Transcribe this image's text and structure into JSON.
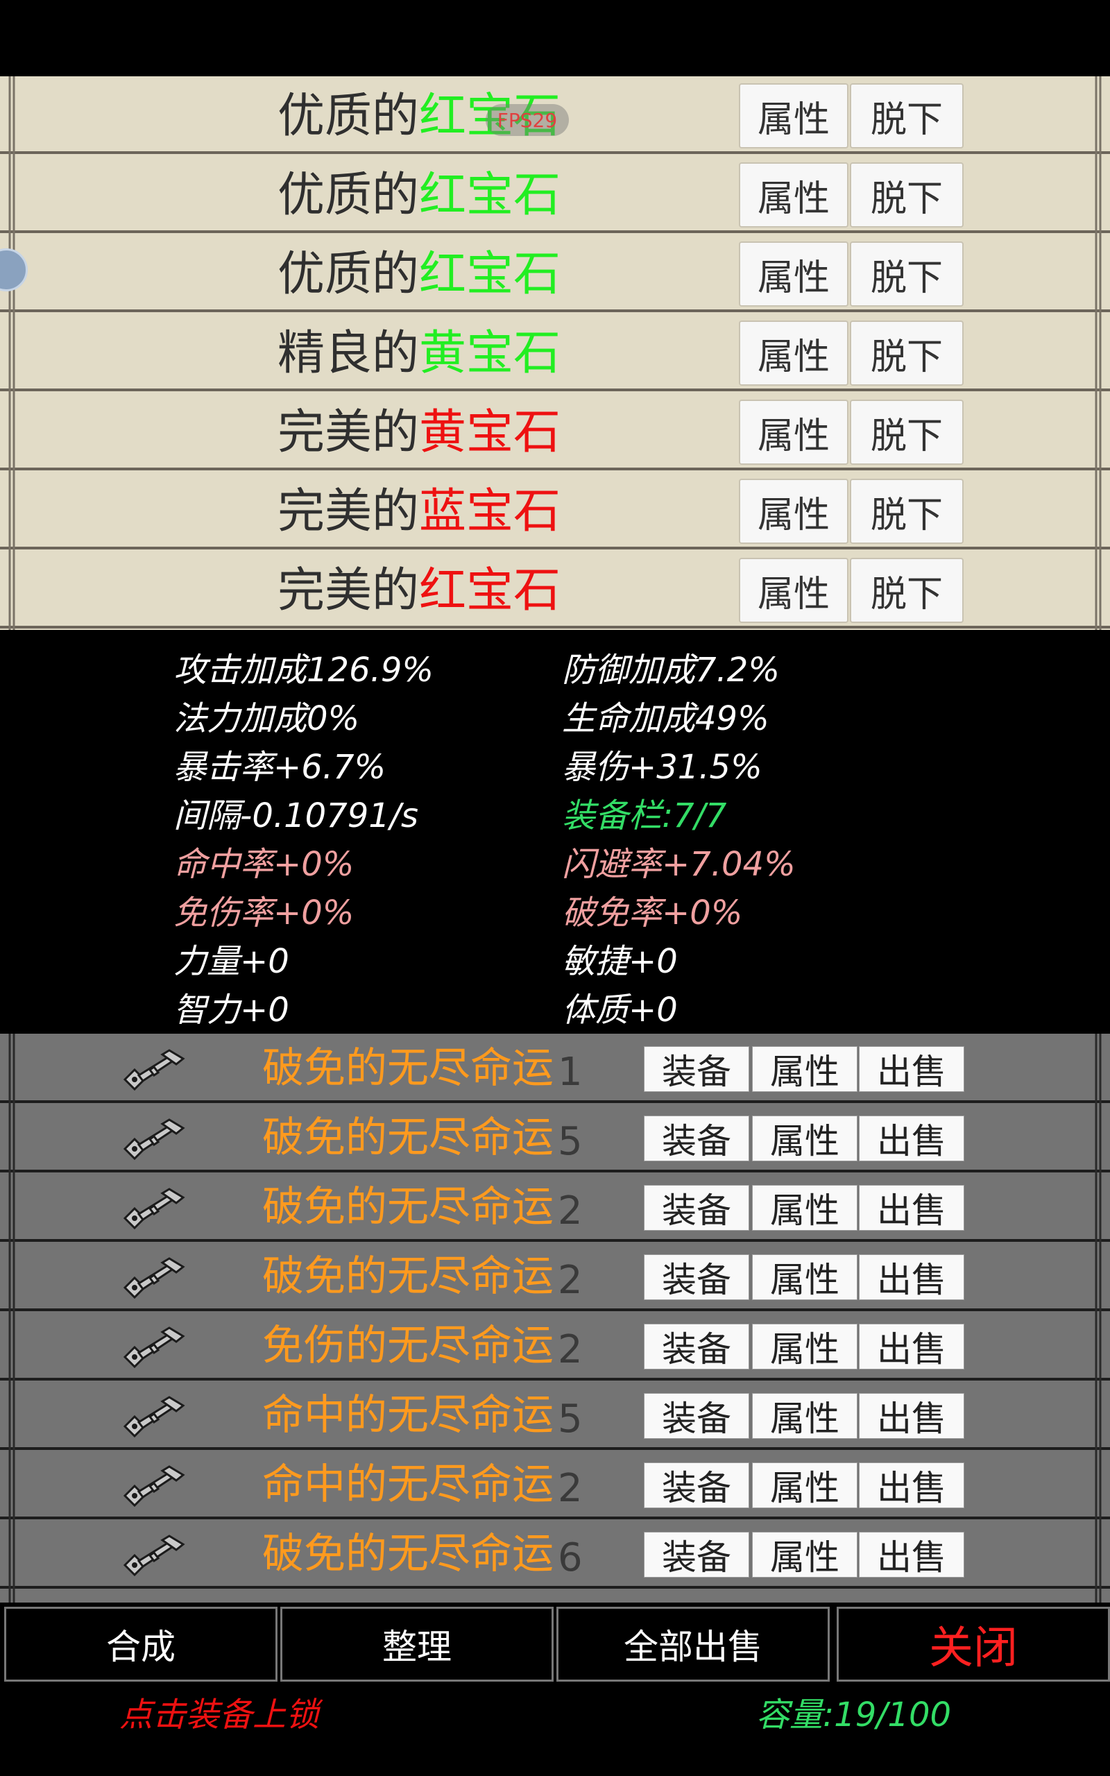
{
  "overlay": {
    "fps_label": "FPS29"
  },
  "equipped": {
    "attr_label": "属性",
    "unequip_label": "脱下",
    "items": [
      {
        "quality": "优质的",
        "gem": "红宝石",
        "gem_color": "#22ee22"
      },
      {
        "quality": "优质的",
        "gem": "红宝石",
        "gem_color": "#22ee22"
      },
      {
        "quality": "优质的",
        "gem": "红宝石",
        "gem_color": "#22ee22"
      },
      {
        "quality": "精良的",
        "gem": "黄宝石",
        "gem_color": "#22ee22"
      },
      {
        "quality": "完美的",
        "gem": "黄宝石",
        "gem_color": "#ee1111"
      },
      {
        "quality": "完美的",
        "gem": "蓝宝石",
        "gem_color": "#ee1111"
      },
      {
        "quality": "完美的",
        "gem": "红宝石",
        "gem_color": "#ee1111"
      }
    ]
  },
  "stats": {
    "colors": {
      "white": "#ffffff",
      "green": "#33dd66",
      "pink": "#f0a0a0"
    },
    "left": [
      {
        "text": "攻击加成126.9%",
        "color": "#ffffff"
      },
      {
        "text": "法力加成0%",
        "color": "#ffffff"
      },
      {
        "text": "暴击率+6.7%",
        "color": "#ffffff"
      },
      {
        "text": "间隔-0.10791/s",
        "color": "#ffffff"
      },
      {
        "text": "命中率+0%",
        "color": "#f0a0a0"
      },
      {
        "text": "免伤率+0%",
        "color": "#f0a0a0"
      },
      {
        "text": "力量+0",
        "color": "#ffffff"
      },
      {
        "text": "智力+0",
        "color": "#ffffff"
      }
    ],
    "right": [
      {
        "text": "防御加成7.2%",
        "color": "#ffffff"
      },
      {
        "text": "生命加成49%",
        "color": "#ffffff"
      },
      {
        "text": "暴伤+31.5%",
        "color": "#ffffff"
      },
      {
        "text": "装备栏:7/7",
        "color": "#33dd66"
      },
      {
        "text": "闪避率+7.04%",
        "color": "#f0a0a0"
      },
      {
        "text": "破免率+0%",
        "color": "#f0a0a0"
      },
      {
        "text": "敏捷+0",
        "color": "#ffffff"
      },
      {
        "text": "体质+0",
        "color": "#ffffff"
      }
    ]
  },
  "bag": {
    "equip_label": "装备",
    "attr_label": "属性",
    "sell_label": "出售",
    "item_icon": "key-icon",
    "name_color": "#ff9a1e",
    "items": [
      {
        "name": "破免的无尽命运",
        "count": "1"
      },
      {
        "name": "破免的无尽命运",
        "count": "5"
      },
      {
        "name": "破免的无尽命运",
        "count": "2"
      },
      {
        "name": "破免的无尽命运",
        "count": "2"
      },
      {
        "name": "免伤的无尽命运",
        "count": "2"
      },
      {
        "name": "命中的无尽命运",
        "count": "5"
      },
      {
        "name": "命中的无尽命运",
        "count": "2"
      },
      {
        "name": "破免的无尽命运",
        "count": "6"
      }
    ]
  },
  "bottom_bar": {
    "synthesize": "合成",
    "organize": "整理",
    "sell_all": "全部出售",
    "close": "关闭",
    "close_color": "#ff2020"
  },
  "footer": {
    "lock_hint": "点击装备上锁",
    "lock_hint_color": "#ee1111",
    "capacity": "容量:19/100",
    "capacity_color": "#33dd66"
  }
}
